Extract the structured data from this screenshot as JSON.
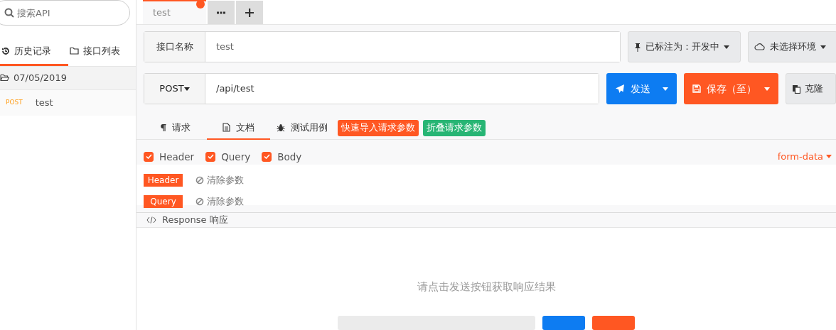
{
  "sidebar": {
    "search": {
      "placeholder": "搜索API"
    },
    "tabs": [
      {
        "label": "历史记录",
        "selected": true
      },
      {
        "label": "接口列表",
        "selected": false
      }
    ],
    "groups": [
      {
        "date": "07/05/2019",
        "expanded": true,
        "items": [
          {
            "method": "POST",
            "name": "test"
          }
        ]
      }
    ]
  },
  "editor_tabs": [
    {
      "label": "test",
      "selected": true,
      "modified": true
    }
  ],
  "name_row": {
    "label": "接口名称",
    "value": "test",
    "status": "已标注为：开发中",
    "environment": "未选择环境"
  },
  "request_row": {
    "method": "POST",
    "url": "/api/test",
    "send": "发送",
    "save": "保存（至）",
    "clone": "克隆"
  },
  "sub_tabs": [
    {
      "label": "请求",
      "selected": false
    },
    {
      "label": "文档",
      "selected": true
    },
    {
      "label": "测试用例",
      "selected": false
    }
  ],
  "quick_actions": [
    {
      "label": "快速导入请求参数",
      "color": "#ff5722"
    },
    {
      "label": "折叠请求参数",
      "color": "#27b574"
    }
  ],
  "filters": [
    {
      "label": "Header",
      "checked": true
    },
    {
      "label": "Query",
      "checked": true
    },
    {
      "label": "Body",
      "checked": true
    }
  ],
  "body_type": "form-data",
  "param_sections": [
    {
      "tag": "Header",
      "action": "清除参数"
    },
    {
      "tag": "Query",
      "action": "清除参数"
    }
  ],
  "response": {
    "title": "Response 响应",
    "empty_message": "请点击发送按钮获取响应结果"
  }
}
